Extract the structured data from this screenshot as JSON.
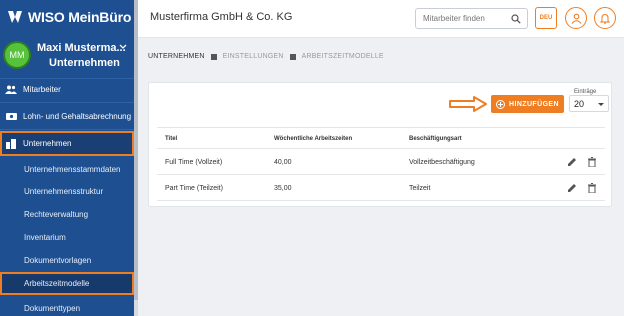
{
  "app": {
    "logo_text": "WISO MeinBüro"
  },
  "user": {
    "initials": "MM",
    "name": "Maxi Musterma...",
    "company": "Unternehmen"
  },
  "sidebar": {
    "items": [
      {
        "label": "Mitarbeiter",
        "icon": "people-icon"
      },
      {
        "label": "Lohn- und Gehaltsabrechnung",
        "icon": "money-icon"
      },
      {
        "label": "Unternehmen",
        "icon": "building-icon",
        "active": true
      }
    ],
    "subitems": [
      {
        "label": "Unternehmensstammdaten"
      },
      {
        "label": "Unternehmensstruktur"
      },
      {
        "label": "Rechteverwaltung"
      },
      {
        "label": "Inventarium"
      },
      {
        "label": "Dokumentvorlagen"
      },
      {
        "label": "Arbeitszeitmodelle",
        "active": true
      },
      {
        "label": "Dokumenttypen"
      }
    ]
  },
  "header": {
    "title": "Musterfirma GmbH & Co. KG",
    "search_placeholder": "Mitarbeiter finden",
    "lang_label": "DEU"
  },
  "breadcrumb": [
    "UNTERNEHMEN",
    "EINSTELLUNGEN",
    "ARBEITSZEITMODELLE"
  ],
  "toolbar": {
    "add_label": "HINZUFÜGEN",
    "entries_label": "Einträge",
    "entries_value": "20"
  },
  "table": {
    "headers": [
      "Titel",
      "Wöchentliche Arbeitszeiten",
      "Beschäftigungsart"
    ],
    "rows": [
      {
        "title": "Full Time (Vollzeit)",
        "hours": "40,00",
        "type": "Vollzeitbeschäftigung"
      },
      {
        "title": "Part Time (Teilzeit)",
        "hours": "35,00",
        "type": "Teilzeit"
      }
    ]
  },
  "colors": {
    "accent": "#ef7d22",
    "sidebar": "#1d4f91"
  }
}
